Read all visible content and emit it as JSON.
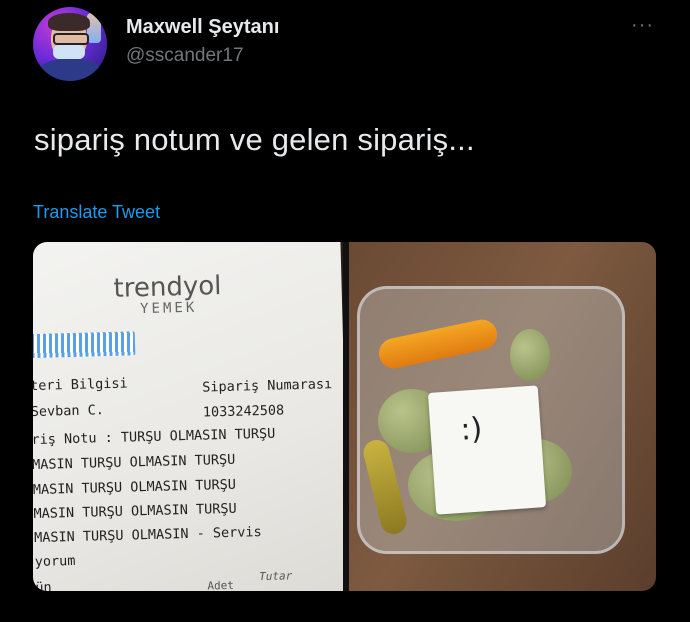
{
  "author": {
    "display_name": "Maxwell Şeytanı",
    "handle": "@sscander17"
  },
  "more_icon": "···",
  "tweet": {
    "text": "sipariş notum ve gelen sipariş...",
    "translate_label": "Translate Tweet"
  },
  "receipt": {
    "brand": "trendyol",
    "brand_sub": "YEMEK",
    "lines": [
      "teri Bilgisi",
      "Sevban C.",
      "riş Notu : TURŞU OLMASIN TURŞU",
      "MASIN TURŞU OLMASIN TURŞU",
      "MASIN TURŞU OLMASIN TURŞU",
      "MASIN TURŞU OLMASIN TURŞU",
      "MASIN TURŞU OLMASIN - Servis",
      "yorum",
      "ün"
    ],
    "order_label": "Sipariş Numarası",
    "order_number": "1033242508",
    "col_adet": "Adet",
    "col_tutar": "Tutar"
  },
  "note_drawing": ":)"
}
